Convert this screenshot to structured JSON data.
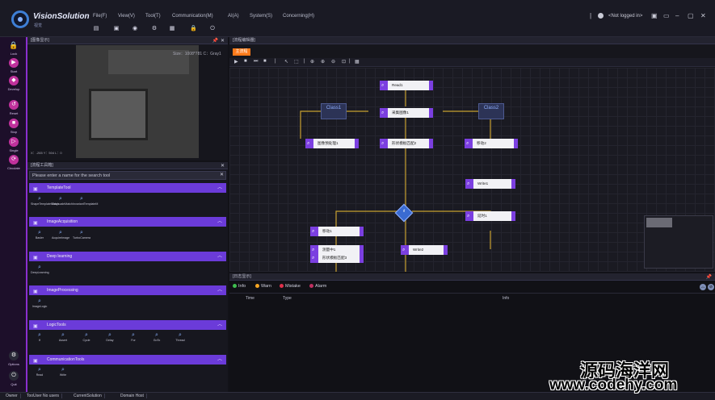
{
  "app": {
    "title": "VisionSolution",
    "subtitle": "视觉",
    "menu": [
      "File(F)",
      "View(V)",
      "Tool(T)",
      "Communication(M)",
      "AI(A)",
      "System(S)",
      "Concerning(H)"
    ],
    "user": "<Not logged in>"
  },
  "leftbar": {
    "items": [
      {
        "label": "Lock",
        "icon": "lock-icon"
      },
      {
        "label": "Start",
        "icon": "play-icon"
      },
      {
        "label": "Develop",
        "icon": "develop-icon"
      },
      {
        "label": "Reset",
        "icon": "reset-icon"
      },
      {
        "label": "Stop",
        "icon": "stop-icon"
      },
      {
        "label": "Single",
        "icon": "single-icon"
      },
      {
        "label": "Circulate",
        "icon": "circulate-icon"
      },
      {
        "label": "Options",
        "icon": "options-icon"
      },
      {
        "label": "Quit",
        "icon": "quit-icon"
      }
    ]
  },
  "image_panel": {
    "header": "[图像显示]",
    "info": "Size：1008*781  C：Gray1",
    "coords": "X：-265  Y：504  L：0"
  },
  "toolbox": {
    "header": "[流程工具箱]",
    "search_placeholder": "Please enter a name for the search tool",
    "categories": [
      {
        "name": "TemplateTool",
        "tools": [
          "ShapeTemplateMatch",
          "GrayscaleMatch",
          "InvariantTemplateM"
        ]
      },
      {
        "name": "ImageAcquisition",
        "tools": [
          "Basler",
          "AcquireImage",
          "TurboCamera"
        ]
      },
      {
        "name": "Deep learning",
        "tools": [
          "DeepLearning"
        ]
      },
      {
        "name": "ImageProcessing",
        "tools": [
          "ImageLogic"
        ]
      },
      {
        "name": "LogicTools",
        "tools": [
          "If",
          "Assert",
          "Cycle",
          "Delay",
          "For",
          "GoTo",
          "Thread"
        ]
      },
      {
        "name": "CommunicationTools",
        "tools": [
          "Read",
          "Write"
        ]
      }
    ]
  },
  "flow": {
    "header": "[流程编辑器]",
    "tab": "主流程",
    "nodes": {
      "read1": "Read1",
      "main": "采集图像1",
      "class1_step": "图像预处理1",
      "main_step": "形状模板匹配2",
      "class2_step": "移动2",
      "left1": "移动1",
      "left2": "形状模板匹配3",
      "left3": "测量中1",
      "write2": "Write2",
      "write1": "Write1",
      "wait1": "延时1"
    },
    "classes": {
      "c1": "Class1",
      "c2": "Class2"
    },
    "decision": "If"
  },
  "log": {
    "header": "[日志显示]",
    "tabs": [
      {
        "label": "Info",
        "color": "#3fbf4f"
      },
      {
        "label": "Warn",
        "color": "#f5a623"
      },
      {
        "label": "Mistake",
        "color": "#e0304a"
      },
      {
        "label": "Alarm",
        "color": "#c03060"
      }
    ],
    "columns": [
      "Time",
      "Type",
      "Info"
    ]
  },
  "status": [
    "Owner",
    "TooUser No users",
    "CurrentSolution",
    "Domain Host"
  ],
  "watermark": {
    "cn": "源码海洋网",
    "url": "www.codehy.com"
  }
}
